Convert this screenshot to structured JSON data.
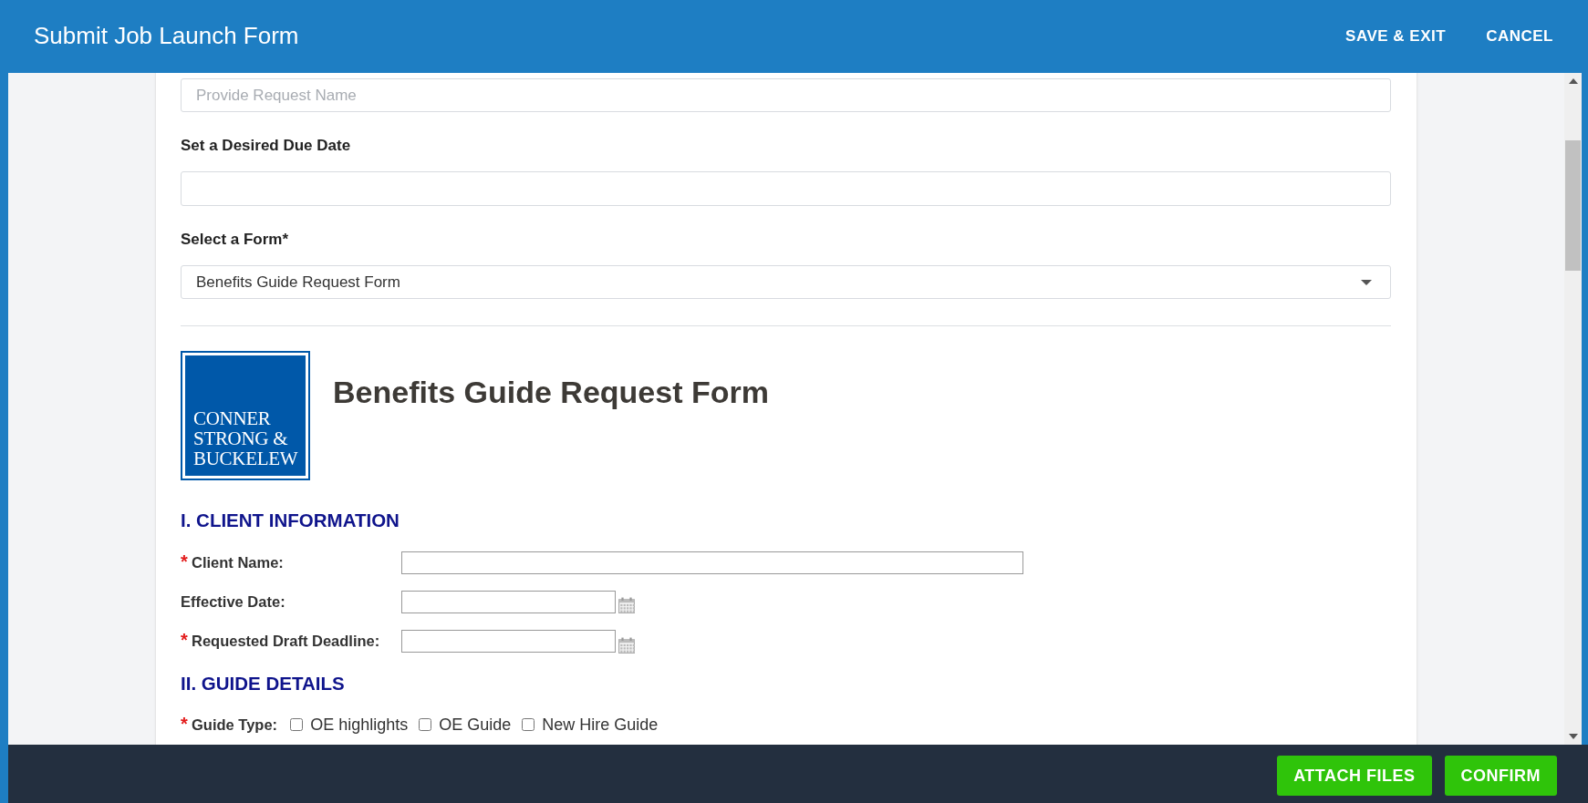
{
  "header": {
    "title": "Submit Job Launch Form",
    "actions": [
      "SAVE & EXIT",
      "CANCEL"
    ]
  },
  "request_name": {
    "placeholder": "Provide Request Name"
  },
  "due_date": {
    "label": "Set a Desired Due Date"
  },
  "form_select": {
    "label": "Select a Form*",
    "value": "Benefits Guide Request Form"
  },
  "form": {
    "logo": [
      "CONNER",
      "STRONG &",
      "BUCKELEW"
    ],
    "title": "Benefits Guide Request Form",
    "sections": [
      {
        "heading": "I. CLIENT INFORMATION",
        "rows": [
          {
            "kind": "text",
            "marker": "*",
            "label": "Client Name:"
          },
          {
            "kind": "date",
            "label": "Effective Date:"
          },
          {
            "kind": "date",
            "marker": "*",
            "label": "Requested Draft Deadline:"
          }
        ]
      },
      {
        "heading": "II. GUIDE DETAILS",
        "rows": [
          {
            "kind": "checkboxes",
            "marker": "*",
            "label": "Guide Type:",
            "options": [
              {
                "label": "OE highlights",
                "checked": false
              },
              {
                "label": "OE Guide",
                "checked": false
              },
              {
                "label": "New Hire Guide",
                "checked": false
              }
            ]
          }
        ]
      }
    ]
  },
  "footer": {
    "buttons": [
      "ATTACH FILES",
      "CONFIRM"
    ]
  }
}
